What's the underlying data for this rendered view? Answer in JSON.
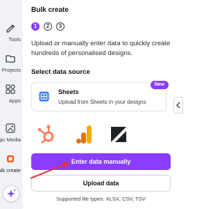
{
  "rail": {
    "items": [
      {
        "label": "Tools",
        "icon": "pencil-ruler-icon"
      },
      {
        "label": "Projects",
        "icon": "folder-icon"
      },
      {
        "label": "Apps",
        "icon": "apps-grid-icon"
      },
      {
        "label": "agic Media",
        "icon": "magic-media-icon"
      },
      {
        "label": "ulk create",
        "icon": "bulk-create-icon",
        "active": true
      }
    ],
    "assistant_icon": "sparkle-icon"
  },
  "panel": {
    "title": "Bulk create",
    "steps": [
      "1",
      "2",
      "3"
    ],
    "active_step": 1,
    "description": "Upload or manually enter data to quickly create hundreds of personalised designs.",
    "section_title": "Select data source",
    "sheets": {
      "title": "Sheets",
      "subtitle": "Upload from Sheets in your designs",
      "badge": "New",
      "icon": "google-sheets-icon"
    },
    "sources": [
      {
        "icon": "hubspot-icon"
      },
      {
        "icon": "google-analytics-icon"
      },
      {
        "icon": "zendesk-icon"
      }
    ],
    "primary_button": "Enter data manually",
    "secondary_button": "Upload data",
    "supported_types": "Supported file types: XLSX, CSV, TSV"
  },
  "colors": {
    "accent": "#8b3dff",
    "arrow": "#e5322d",
    "rail_bg": "#f1f2f6"
  }
}
